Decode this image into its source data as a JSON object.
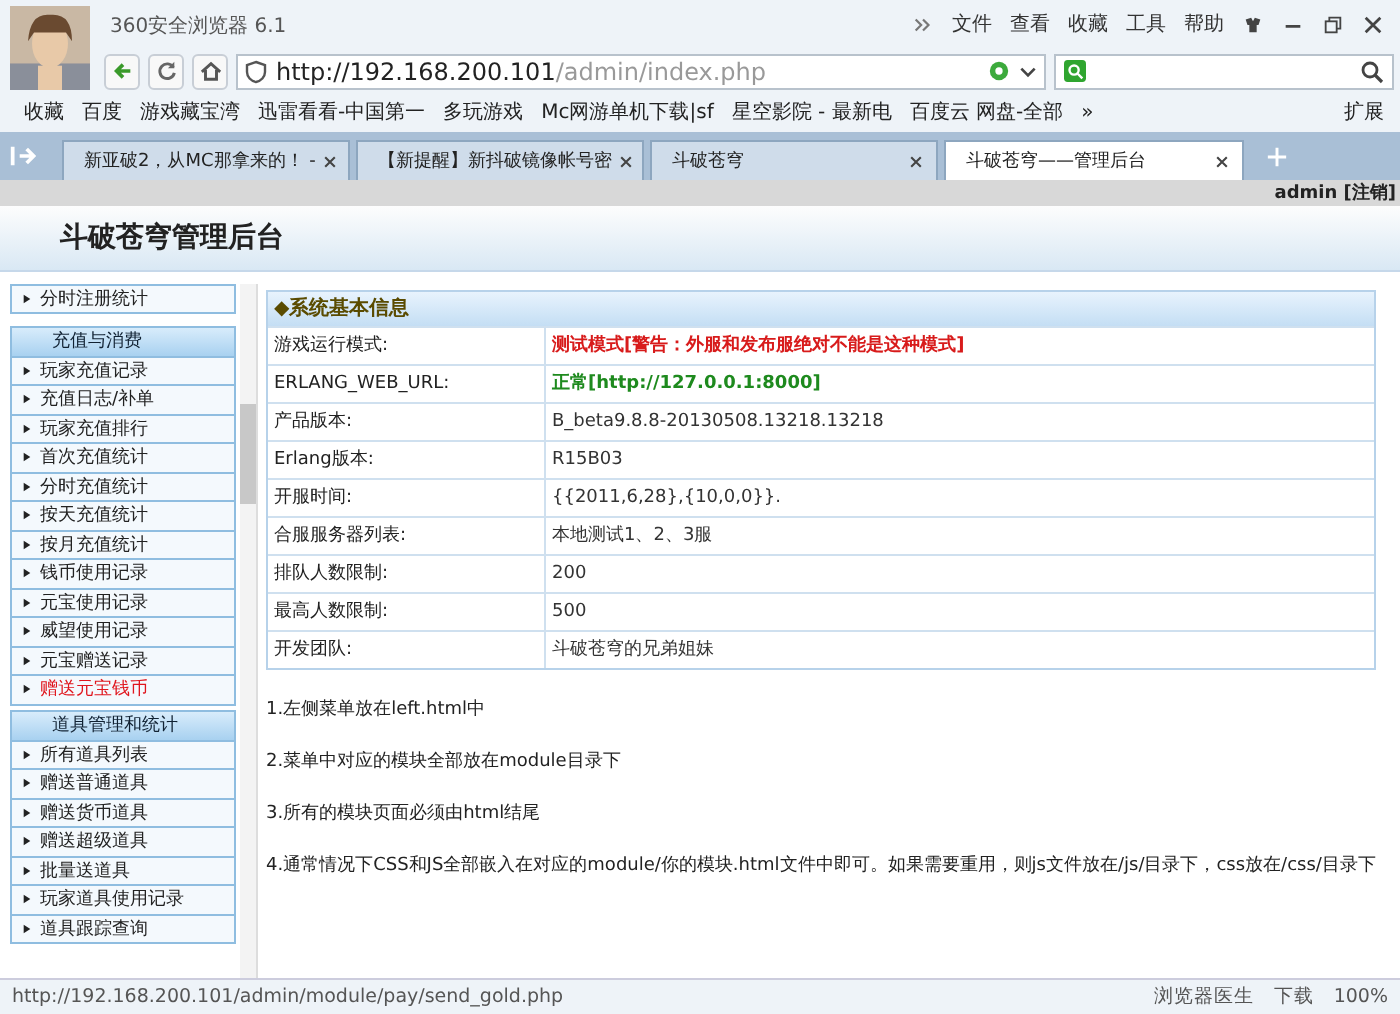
{
  "window": {
    "title": "360安全浏览器 6.1",
    "menu": [
      "文件",
      "查看",
      "收藏",
      "工具",
      "帮助"
    ]
  },
  "address_bar": {
    "url_host": "http://192.168.200.101",
    "url_path": "/admin/index.php"
  },
  "bookmarks": [
    "收藏",
    "百度",
    "游戏藏宝湾",
    "迅雷看看-中国第一",
    "多玩游戏",
    "Mc网游单机下载|sf",
    "星空影院 - 最新电",
    "百度云 网盘-全部",
    "»"
  ],
  "extensions_label": "扩展",
  "tabs": [
    {
      "label": "新亚破2，从MC那拿来的！ -",
      "selected": false
    },
    {
      "label": "【新提醒】新抖破镜像帐号密",
      "selected": false
    },
    {
      "label": "斗破苍穹",
      "selected": false
    },
    {
      "label": "斗破苍穹——管理后台",
      "selected": true
    }
  ],
  "page": {
    "user": "admin [注销]",
    "title": "斗破苍穹管理后台"
  },
  "sidebar": {
    "items": [
      {
        "kind": "item",
        "label": "分时注册统计",
        "selected": false
      },
      {
        "kind": "group",
        "label": "充值与消费"
      },
      {
        "kind": "item",
        "label": "玩家充值记录",
        "selected": false
      },
      {
        "kind": "item",
        "label": "充值日志/补单",
        "selected": false
      },
      {
        "kind": "item",
        "label": "玩家充值排行",
        "selected": false
      },
      {
        "kind": "item",
        "label": "首次充值统计",
        "selected": false
      },
      {
        "kind": "item",
        "label": "分时充值统计",
        "selected": false
      },
      {
        "kind": "item",
        "label": "按天充值统计",
        "selected": false
      },
      {
        "kind": "item",
        "label": "按月充值统计",
        "selected": false
      },
      {
        "kind": "item",
        "label": "钱币使用记录",
        "selected": false
      },
      {
        "kind": "item",
        "label": "元宝使用记录",
        "selected": false
      },
      {
        "kind": "item",
        "label": "威望使用记录",
        "selected": false
      },
      {
        "kind": "item",
        "label": "元宝赠送记录",
        "selected": false
      },
      {
        "kind": "item",
        "label": "赠送元宝钱币",
        "selected": true
      },
      {
        "kind": "group",
        "label": "道具管理和统计"
      },
      {
        "kind": "item",
        "label": "所有道具列表",
        "selected": false
      },
      {
        "kind": "item",
        "label": "赠送普通道具",
        "selected": false
      },
      {
        "kind": "item",
        "label": "赠送货币道具",
        "selected": false
      },
      {
        "kind": "item",
        "label": "赠送超级道具",
        "selected": false
      },
      {
        "kind": "item",
        "label": "批量送道具",
        "selected": false
      },
      {
        "kind": "item",
        "label": "玩家道具使用记录",
        "selected": false
      },
      {
        "kind": "item",
        "label": "道具跟踪查询",
        "selected": false
      }
    ]
  },
  "info_table": {
    "title": "◆系统基本信息",
    "rows": [
      {
        "label": "游戏运行模式:",
        "value": "测试模式[警告：外服和发布服绝对不能是这种模式]",
        "kind": "warning"
      },
      {
        "label": "ERLANG_WEB_URL:",
        "value": "正常[http://127.0.0.1:8000]",
        "kind": "ok"
      },
      {
        "label": "产品版本:",
        "value": "B_beta9.8.8-20130508.13218.13218",
        "kind": "plain"
      },
      {
        "label": "Erlang版本:",
        "value": "R15B03",
        "kind": "plain"
      },
      {
        "label": "开服时间:",
        "value": "{{2011,6,28},{10,0,0}}.",
        "kind": "plain"
      },
      {
        "label": "合服服务器列表:",
        "value": "本地测试1、2、3服",
        "kind": "plain"
      },
      {
        "label": "排队人数限制:",
        "value": "200",
        "kind": "plain"
      },
      {
        "label": "最高人数限制:",
        "value": "500",
        "kind": "plain"
      },
      {
        "label": "开发团队:",
        "value": "斗破苍穹的兄弟姐妹",
        "kind": "plain"
      }
    ]
  },
  "notes": [
    "1.左侧菜单放在left.html中",
    "2.菜单中对应的模块全部放在module目录下",
    "3.所有的模块页面必须由html结尾",
    "4.通常情况下CSS和JS全部嵌入在对应的module/你的模块.html文件中即可。如果需要重用，则js文件放在/js/目录下，css放在/css/目录下"
  ],
  "status_bar": {
    "url": "http://192.168.200.101/admin/module/pay/send_gold.php",
    "doctor": "浏览器医生",
    "download": "下载",
    "zoom": "100%"
  }
}
